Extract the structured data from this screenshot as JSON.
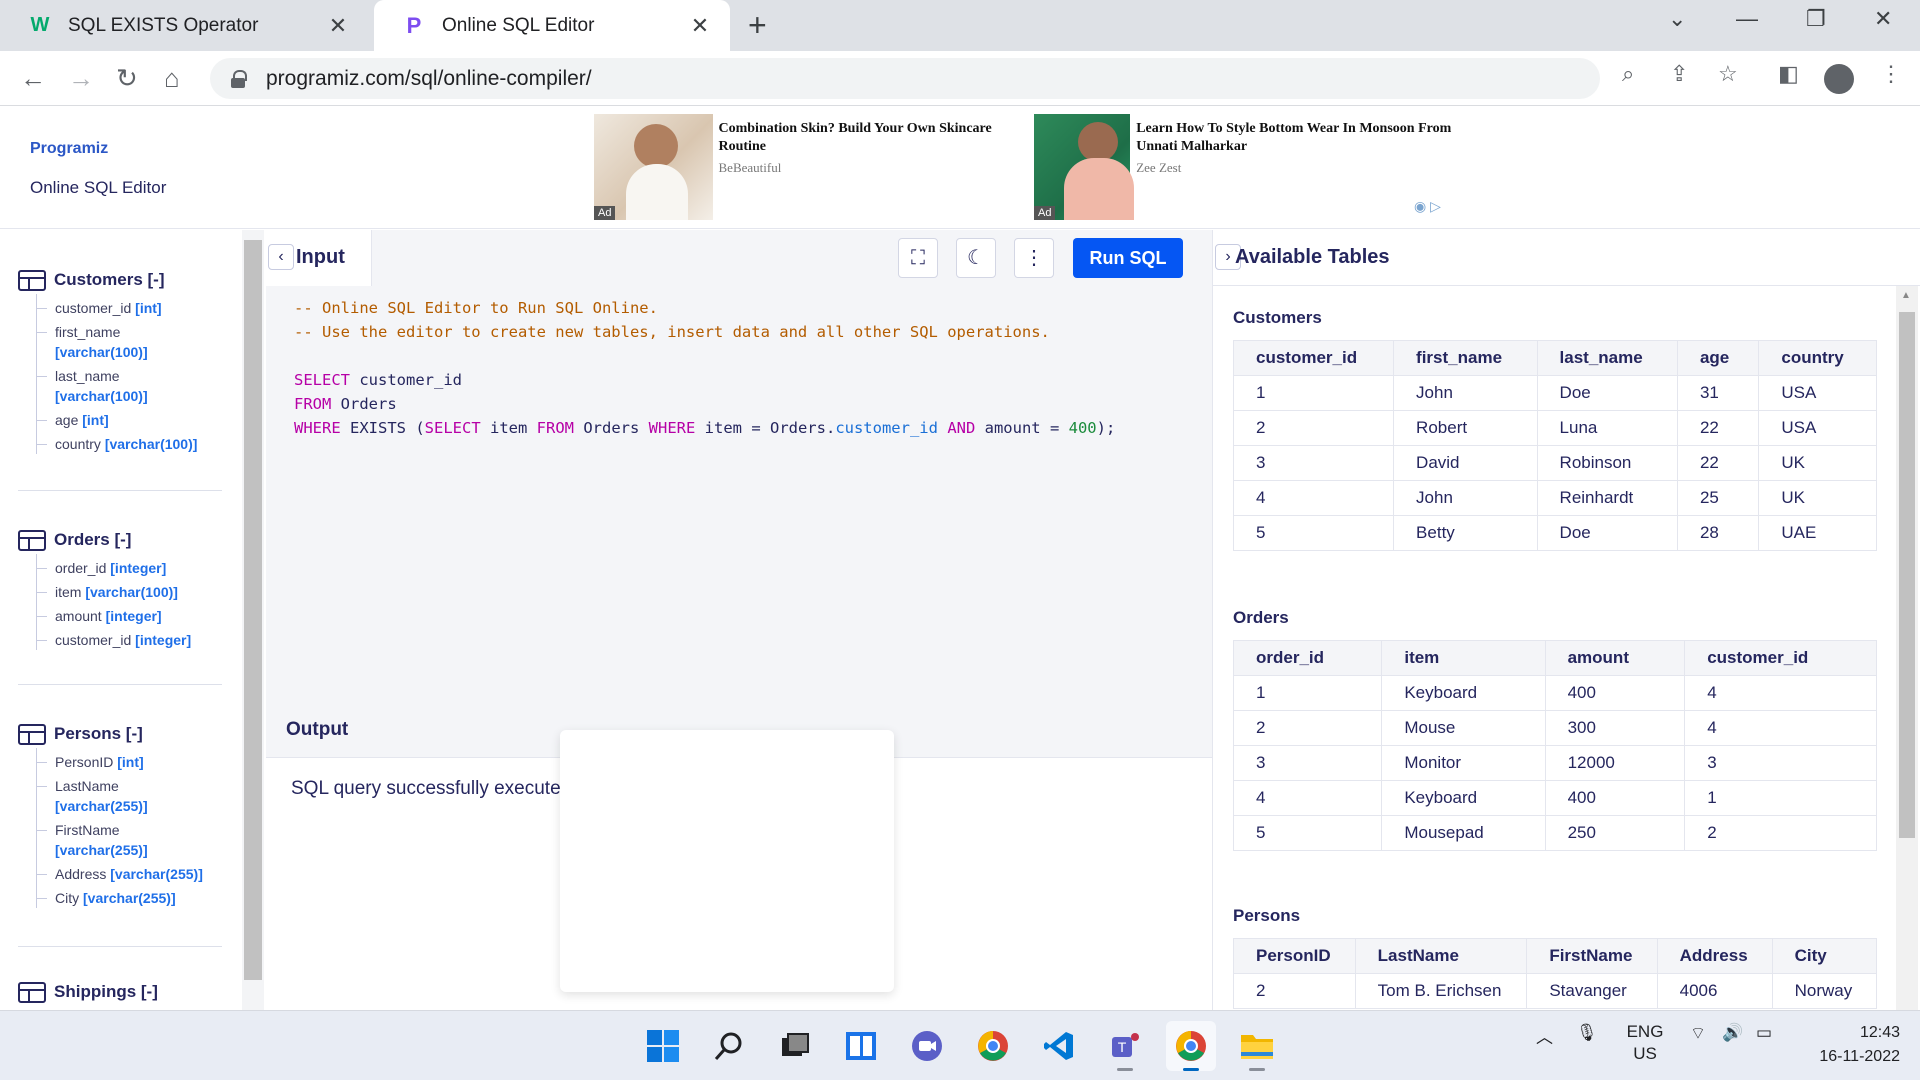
{
  "browser": {
    "tabs": [
      {
        "title": "SQL EXISTS Operator",
        "icon": "w3schools-icon"
      },
      {
        "title": "Online SQL Editor",
        "icon": "programiz-icon"
      }
    ],
    "url": "programiz.com/sql/online-compiler/"
  },
  "header": {
    "logo": "Programiz",
    "title": "Online SQL Editor",
    "ads": [
      {
        "headline": "Combination Skin? Build Your Own Skincare Routine",
        "source": "BeBeautiful",
        "tag": "Ad"
      },
      {
        "headline": "Learn How To Style Bottom Wear In Monsoon From Unnati Malharkar",
        "source": "Zee Zest",
        "tag": "Ad"
      }
    ]
  },
  "sidebar": {
    "tables": [
      {
        "name": "Customers [-]",
        "columns": [
          {
            "name": "customer_id",
            "type": "[int]"
          },
          {
            "name": "first_name",
            "type": "[varchar(100)]"
          },
          {
            "name": "last_name",
            "type": "[varchar(100)]"
          },
          {
            "name": "age",
            "type": "[int]"
          },
          {
            "name": "country",
            "type": "[varchar(100)]"
          }
        ]
      },
      {
        "name": "Orders [-]",
        "columns": [
          {
            "name": "order_id",
            "type": "[integer]"
          },
          {
            "name": "item",
            "type": "[varchar(100)]"
          },
          {
            "name": "amount",
            "type": "[integer]"
          },
          {
            "name": "customer_id",
            "type": "[integer]"
          }
        ]
      },
      {
        "name": "Persons [-]",
        "columns": [
          {
            "name": "PersonID",
            "type": "[int]"
          },
          {
            "name": "LastName",
            "type": "[varchar(255)]"
          },
          {
            "name": "FirstName",
            "type": "[varchar(255)]"
          },
          {
            "name": "Address",
            "type": "[varchar(255)]"
          },
          {
            "name": "City",
            "type": "[varchar(255)]"
          }
        ]
      },
      {
        "name": "Shippings [-]",
        "columns": []
      }
    ]
  },
  "editor": {
    "input_label": "Input",
    "run_label": "Run SQL",
    "code_lines": [
      "-- Online SQL Editor to Run SQL Online.",
      "-- Use the editor to create new tables, insert data and all other SQL operations.",
      "",
      "SELECT customer_id",
      "FROM Orders",
      "WHERE EXISTS (SELECT item FROM Orders WHERE item = Orders.customer_id AND amount = 400);"
    ],
    "output_label": "Output",
    "output_text": "SQL query successfully executed. However, the result set is empty."
  },
  "available": {
    "title": "Available Tables",
    "customers": {
      "name": "Customers",
      "headers": [
        "customer_id",
        "first_name",
        "last_name",
        "age",
        "country"
      ],
      "rows": [
        [
          "1",
          "John",
          "Doe",
          "31",
          "USA"
        ],
        [
          "2",
          "Robert",
          "Luna",
          "22",
          "USA"
        ],
        [
          "3",
          "David",
          "Robinson",
          "22",
          "UK"
        ],
        [
          "4",
          "John",
          "Reinhardt",
          "25",
          "UK"
        ],
        [
          "5",
          "Betty",
          "Doe",
          "28",
          "UAE"
        ]
      ]
    },
    "orders": {
      "name": "Orders",
      "headers": [
        "order_id",
        "item",
        "amount",
        "customer_id"
      ],
      "rows": [
        [
          "1",
          "Keyboard",
          "400",
          "4"
        ],
        [
          "2",
          "Mouse",
          "300",
          "4"
        ],
        [
          "3",
          "Monitor",
          "12000",
          "3"
        ],
        [
          "4",
          "Keyboard",
          "400",
          "1"
        ],
        [
          "5",
          "Mousepad",
          "250",
          "2"
        ]
      ]
    },
    "persons": {
      "name": "Persons",
      "headers": [
        "PersonID",
        "LastName",
        "FirstName",
        "Address",
        "City"
      ],
      "rows": [
        [
          "2",
          "Tom B. Erichsen",
          "Stavanger",
          "4006",
          "Norway"
        ]
      ]
    }
  },
  "taskbar": {
    "lang_top": "ENG",
    "lang_bottom": "US",
    "time": "12:43",
    "date": "16-11-2022"
  }
}
